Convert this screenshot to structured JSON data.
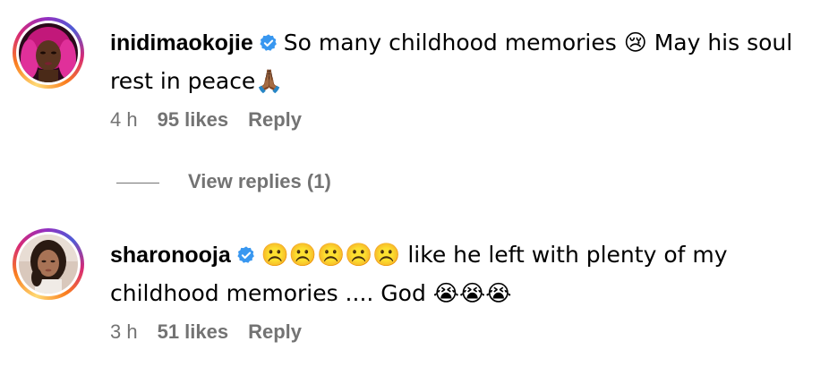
{
  "comments": [
    {
      "username": "inidimaokojie",
      "text": "So many childhood memories 😢 May his soul rest in peace🙏🏾",
      "time": "4 h",
      "likes": "95 likes",
      "reply": "Reply",
      "verified_icon": "verified-badge-icon"
    },
    {
      "username": "sharonooja",
      "text": "☹️☹️☹️☹️☹️ like he left with plenty of my childhood memories .... God 😭😭😭",
      "time": "3 h",
      "likes": "51 likes",
      "reply": "Reply",
      "verified_icon": "verified-badge-icon"
    }
  ],
  "view_replies": "View replies (1)",
  "colors": {
    "verified_blue": "#3897f0",
    "meta_gray": "#737373",
    "ring_gradient": [
      "#feda75",
      "#fa7e1e",
      "#d62976",
      "#962fbf",
      "#4f5bd5"
    ]
  }
}
